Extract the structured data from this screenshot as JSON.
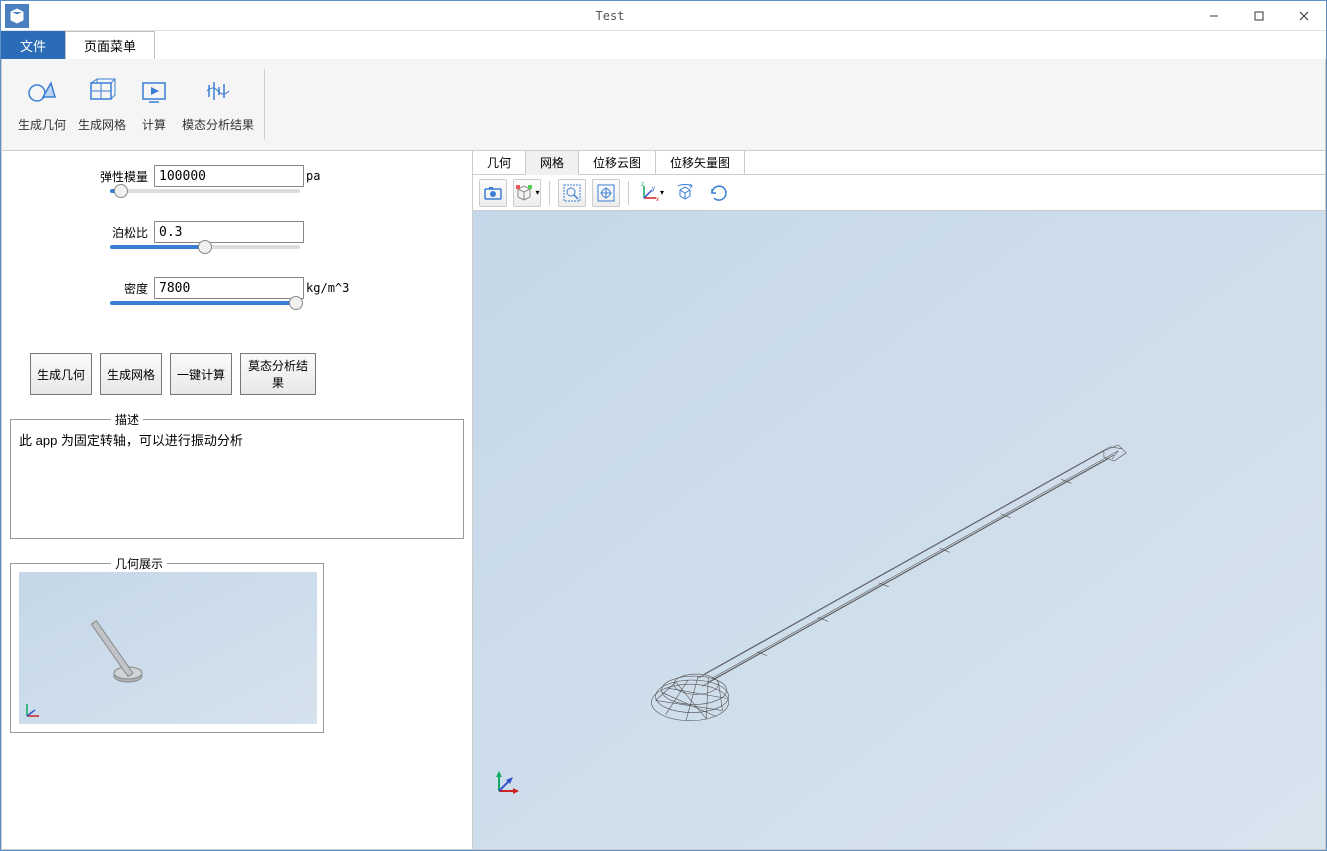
{
  "window": {
    "title": "Test"
  },
  "menu": {
    "file": "文件",
    "pageMenu": "页面菜单"
  },
  "ribbon": {
    "genGeometry": "生成几何",
    "genMesh": "生成网格",
    "compute": "计算",
    "modalResults": "模态分析结果"
  },
  "params": {
    "elasticModulus": {
      "label": "弹性模量",
      "value": "100000",
      "unit": "pa",
      "sliderPct": 6
    },
    "poisson": {
      "label": "泊松比",
      "value": "0.3",
      "unit": "",
      "sliderPct": 50
    },
    "density": {
      "label": "密度",
      "value": "7800",
      "unit": "kg/m^3",
      "sliderPct": 98
    }
  },
  "buttons": {
    "genGeometry": "生成几何",
    "genMesh": "生成网格",
    "oneClickCalc": "一键计算",
    "modalResults": "莫态分析结果"
  },
  "description": {
    "legend": "描述",
    "text": "此 app 为固定转轴，可以进行振动分析"
  },
  "preview": {
    "legend": "几何展示"
  },
  "viewTabs": {
    "geometry": "几何",
    "mesh": "网格",
    "displacementCloud": "位移云图",
    "displacementVector": "位移矢量图"
  }
}
